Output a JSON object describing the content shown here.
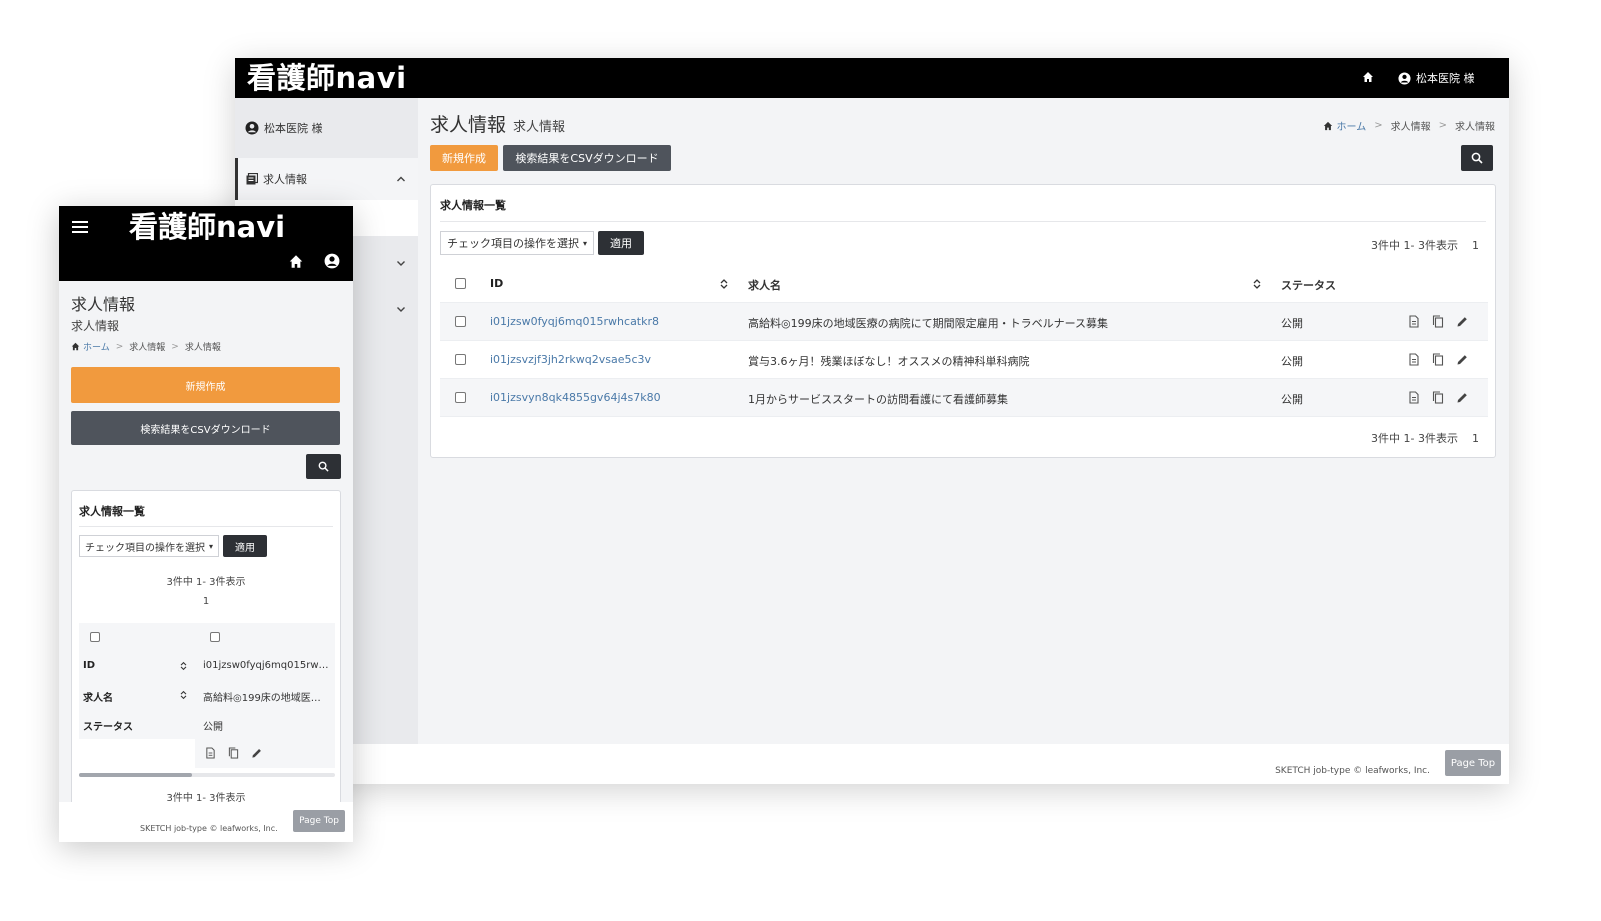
{
  "brand": {
    "logo": "看護師navi"
  },
  "header": {
    "user_label": "松本医院 様"
  },
  "sidebar": {
    "user_label": "松本医院 様",
    "items": [
      {
        "label": "求人情報"
      }
    ]
  },
  "page": {
    "title": "求人情報",
    "subtitle": "求人情報"
  },
  "breadcrumb": {
    "home": "ホーム",
    "section": "求人情報",
    "current": "求人情報"
  },
  "toolbar": {
    "new_label": "新規作成",
    "csv_label": "検索結果をCSVダウンロード"
  },
  "list": {
    "title": "求人情報一覧",
    "bulk_select": "チェック項目の操作を選択",
    "apply_label": "適用",
    "pager_text": "3件中 1- 3件表示",
    "page_num": "1",
    "columns": {
      "id": "ID",
      "name": "求人名",
      "status": "ステータス"
    },
    "rows": [
      {
        "id": "i01jzsw0fyqj6mq015rwhcatkr8",
        "name": "高給料◎199床の地域医療の病院にて期間限定雇用・トラベルナース募集",
        "status": "公開"
      },
      {
        "id": "i01jzsvzjf3jh2rkwq2vsae5c3v",
        "name": "賞与3.6ヶ月！残業ほぼなし！オススメの精神科単科病院",
        "status": "公開"
      },
      {
        "id": "i01jzsvyn8qk4855gv64j4s7k80",
        "name": "1月からサービススタートの訪問看護にて看護師募集",
        "status": "公開"
      }
    ]
  },
  "mobile": {
    "row_id": "i01jzsw0fyqj6mq015rw…",
    "row_name": "高給料◎199床の地域医…"
  },
  "footer": {
    "copyright": "SKETCH job-type © leafworks, Inc.",
    "page_top": "Page Top"
  },
  "icons": {
    "home": "home-icon",
    "user": "user-circle-icon",
    "list": "list-icon",
    "chevron_up": "chevron-up-icon",
    "chevron_down": "chevron-down-icon",
    "search": "search-icon",
    "sort": "sort-icon",
    "doc": "document-icon",
    "copy": "copy-icon",
    "edit": "pencil-icon",
    "menu": "hamburger-icon"
  },
  "colors": {
    "accent_orange": "#f19a3e",
    "dark_button": "#4f545c",
    "header_bg": "#000000",
    "link": "#4a79a8"
  }
}
